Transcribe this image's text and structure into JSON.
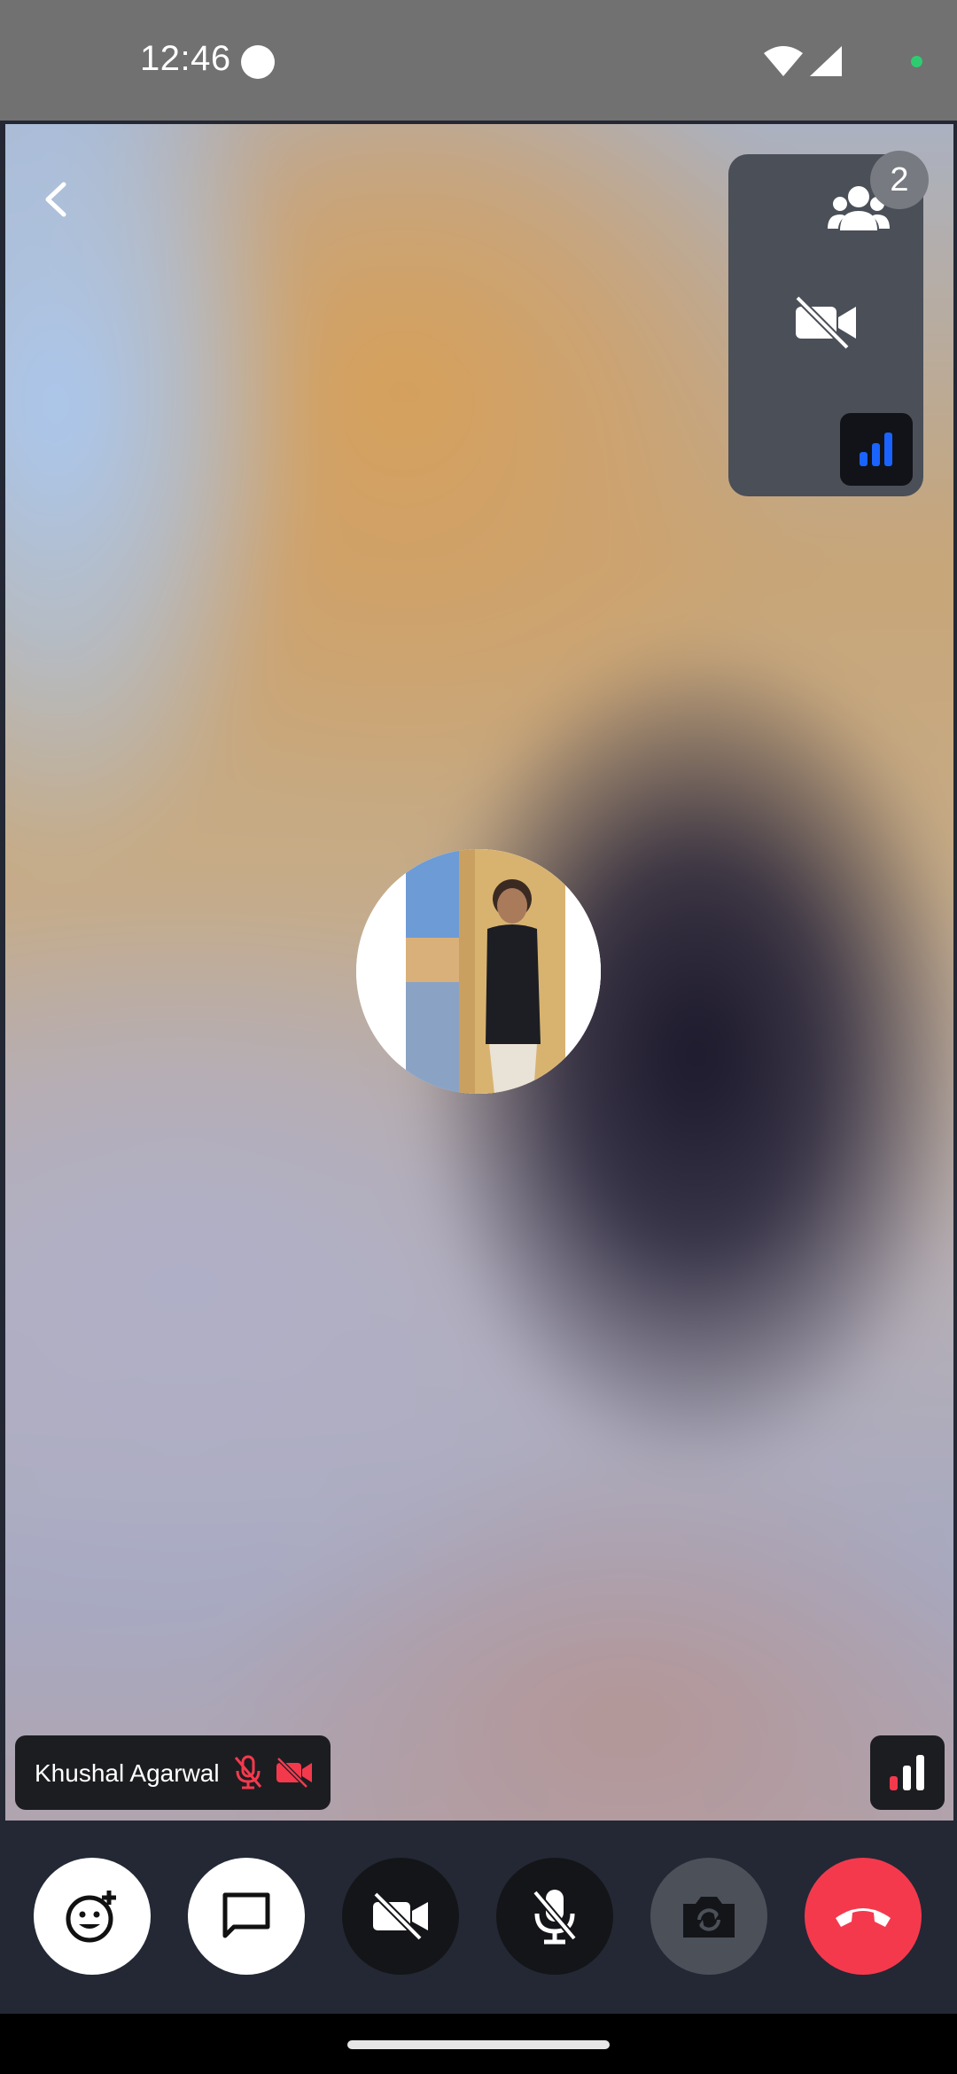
{
  "status_bar": {
    "time": "12:46"
  },
  "call": {
    "participant_count": "2",
    "remote_participant_name": "Khushal Agarwal",
    "remote_mic_muted": true,
    "remote_video_off": true
  },
  "colors": {
    "end_call": "#f5394d",
    "muted_indicator": "#f5394d",
    "good_signal": "#1a63ff",
    "poor_signal": "#f5394d"
  },
  "controls": [
    {
      "name": "add-reaction",
      "icon": "emoji-add-icon"
    },
    {
      "name": "chat",
      "icon": "chat-bubble-icon"
    },
    {
      "name": "toggle-video",
      "icon": "video-off-icon"
    },
    {
      "name": "toggle-mic",
      "icon": "mic-off-icon"
    },
    {
      "name": "flip-camera",
      "icon": "camera-flip-icon"
    },
    {
      "name": "end-call",
      "icon": "phone-hangup-icon"
    }
  ]
}
